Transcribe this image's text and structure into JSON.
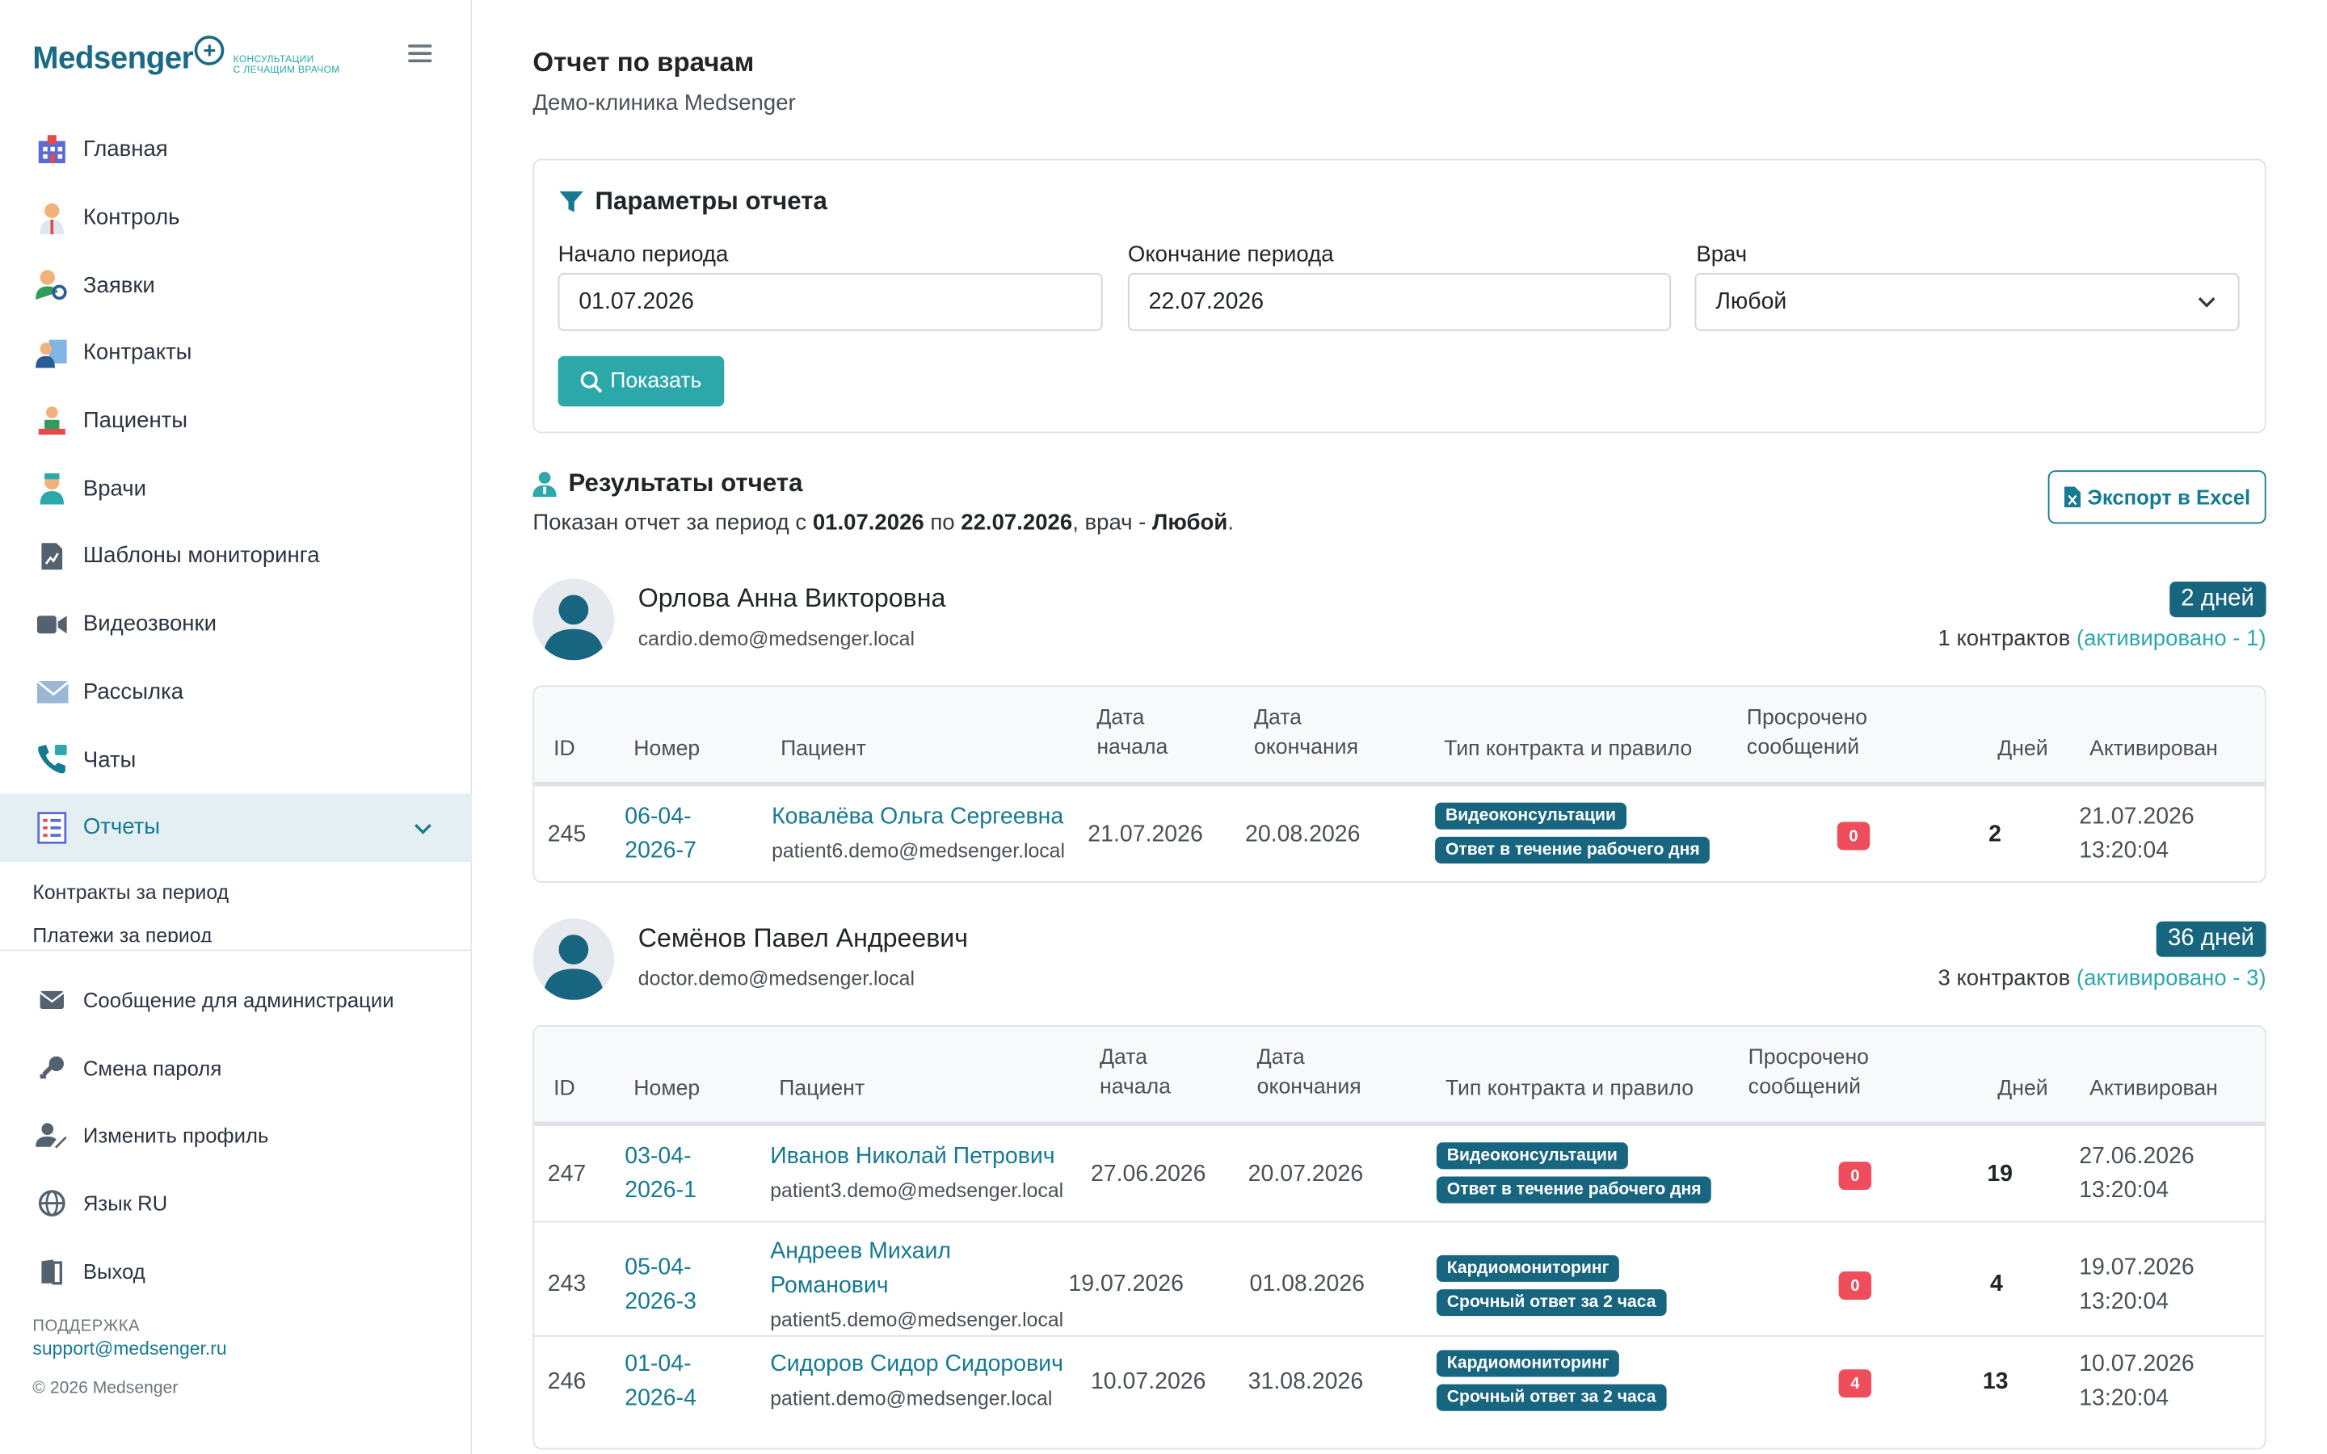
{
  "brand": {
    "name_a": "Medsenger",
    "tagline_1": "КОНСУЛЬТАЦИИ",
    "tagline_2": "С ЛЕЧАЩИМ ВРАЧОМ"
  },
  "nav": [
    {
      "label": "Главная",
      "icon": "hospital-icon"
    },
    {
      "label": "Контроль",
      "icon": "doctor-icon"
    },
    {
      "label": "Заявки",
      "icon": "user-search-icon"
    },
    {
      "label": "Контракты",
      "icon": "contract-icon"
    },
    {
      "label": "Пациенты",
      "icon": "patients-icon"
    },
    {
      "label": "Врачи",
      "icon": "nurse-icon"
    },
    {
      "label": "Шаблоны мониторинга",
      "icon": "file-chart-icon"
    },
    {
      "label": "Видеозвонки",
      "icon": "video-icon"
    },
    {
      "label": "Рассылка",
      "icon": "mail-icon"
    },
    {
      "label": "Чаты",
      "icon": "phone-chat-icon"
    },
    {
      "label": "Отчеты",
      "icon": "report-icon"
    }
  ],
  "subnav": [
    "Контракты за период",
    "Платежи за период"
  ],
  "bottom_nav": [
    {
      "label": "Сообщение для администрации",
      "icon": "envelope-icon"
    },
    {
      "label": "Смена пароля",
      "icon": "key-icon"
    },
    {
      "label": "Изменить профиль",
      "icon": "user-edit-icon"
    },
    {
      "label": "Язык RU",
      "icon": "globe-icon"
    },
    {
      "label": "Выход",
      "icon": "exit-icon"
    }
  ],
  "support": {
    "label": "ПОДДЕРЖКА",
    "email": "support@medsenger.ru",
    "copyright": "© 2026 Medsenger"
  },
  "page": {
    "title": "Отчет по врачам",
    "subtitle": "Демо-клиника Medsenger"
  },
  "params": {
    "heading": "Параметры отчета",
    "start_label": "Начало периода",
    "start_value": "01.07.2026",
    "end_label": "Окончание периода",
    "end_value": "22.07.2026",
    "doctor_label": "Врач",
    "doctor_value": "Любой",
    "show_button": "Показать"
  },
  "results": {
    "heading": "Результаты отчета",
    "export_button": "Экспорт в Excel",
    "summary_prefix": "Показан отчет за период с ",
    "from": "01.07.2026",
    "mid": " по ",
    "to": "22.07.2026",
    "doc_part": ", врач - ",
    "doctor": "Любой",
    "end": "."
  },
  "table_headers": {
    "id": "ID",
    "number": "Номер",
    "patient": "Пациент",
    "start_1": "Дата",
    "start_2": "начала",
    "end_1": "Дата",
    "end_2": "окончания",
    "type": "Тип контракта и правило",
    "overdue_1": "Просрочено",
    "overdue_2": "сообщений",
    "days": "Дней",
    "activated": "Активирован"
  },
  "doctors": [
    {
      "name": "Орлова Анна Викторовна",
      "email": "cardio.demo@medsenger.local",
      "days_badge": "2 дней",
      "contracts": "1 контрактов ",
      "activated": "(активировано - 1)",
      "rows": [
        {
          "id": "245",
          "num_1": "06-04-",
          "num_2": "2026-7",
          "patient_1": "Ковалёва Ольга Сергеевна",
          "patient_2": "",
          "email": "patient6.demo@medsenger.local",
          "start": "21.07.2026",
          "end": "20.08.2026",
          "tag_1": "Видеоконсультации",
          "tag_2": "Ответ в течение рабочего дня",
          "overdue": "0",
          "days": "2",
          "act_date": "21.07.2026",
          "act_time": "13:20:04"
        }
      ]
    },
    {
      "name": "Семёнов Павел Андреевич",
      "email": "doctor.demo@medsenger.local",
      "days_badge": "36 дней",
      "contracts": "3 контрактов ",
      "activated": "(активировано - 3)",
      "rows": [
        {
          "id": "247",
          "num_1": "03-04-",
          "num_2": "2026-1",
          "patient_1": "Иванов Николай Петрович",
          "patient_2": "",
          "email": "patient3.demo@medsenger.local",
          "start": "27.06.2026",
          "end": "20.07.2026",
          "tag_1": "Видеоконсультации",
          "tag_2": "Ответ в течение рабочего дня",
          "overdue": "0",
          "days": "19",
          "act_date": "27.06.2026",
          "act_time": "13:20:04"
        },
        {
          "id": "243",
          "num_1": "05-04-",
          "num_2": "2026-3",
          "patient_1": "Андреев Михаил",
          "patient_2": "Романович",
          "email": "patient5.demo@medsenger.local",
          "start": "19.07.2026",
          "end": "01.08.2026",
          "tag_1": "Кардиомониторинг",
          "tag_2": "Срочный ответ за 2 часа",
          "overdue": "0",
          "days": "4",
          "act_date": "19.07.2026",
          "act_time": "13:20:04"
        },
        {
          "id": "246",
          "num_1": "01-04-",
          "num_2": "2026-4",
          "patient_1": "Сидоров Сидор Сидорович",
          "patient_2": "",
          "email": "patient.demo@medsenger.local",
          "start": "10.07.2026",
          "end": "31.08.2026",
          "tag_1": "Кардиомониторинг",
          "tag_2": "Срочный ответ за 2 часа",
          "overdue": "4",
          "days": "13",
          "act_date": "10.07.2026",
          "act_time": "13:20:04"
        }
      ]
    }
  ]
}
